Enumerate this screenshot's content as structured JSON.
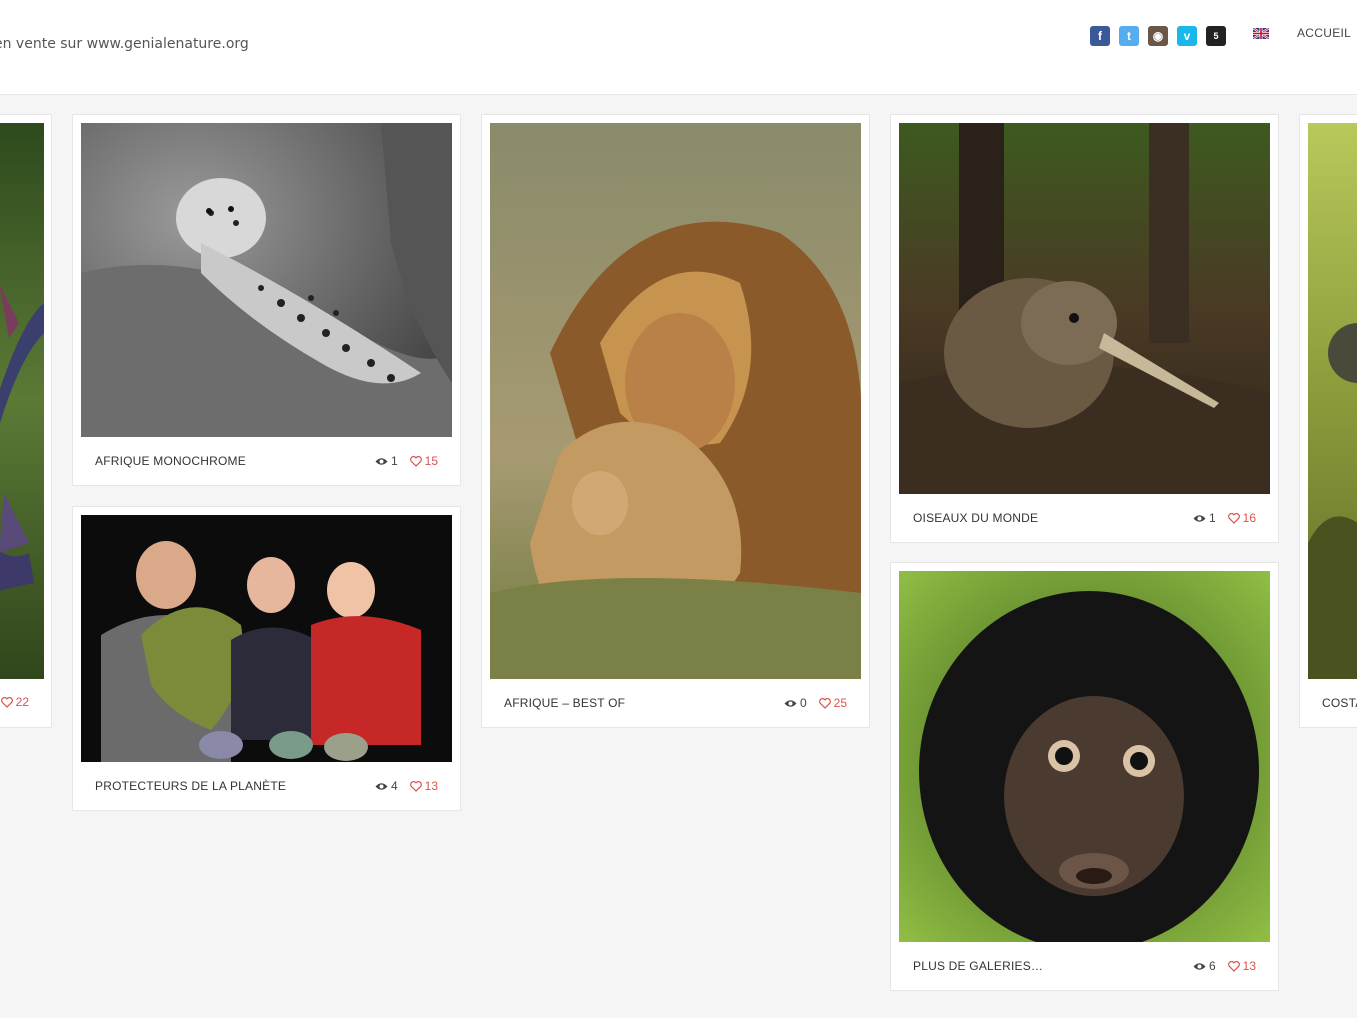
{
  "header": {
    "tagline": "en vente sur www.genialenature.org",
    "social": [
      {
        "name": "facebook-icon",
        "glyph": "f",
        "color": "#3b5998"
      },
      {
        "name": "twitter-icon",
        "glyph": "t",
        "color": "#55acee"
      },
      {
        "name": "instagram-icon",
        "glyph": "◉",
        "color": "#6b5648"
      },
      {
        "name": "vimeo-icon",
        "glyph": "v",
        "color": "#1ab7ea"
      },
      {
        "name": "500px-icon",
        "glyph": "5",
        "color": "#222222"
      }
    ],
    "language_icon": "uk-flag-icon",
    "nav_home": "ACCUEIL"
  },
  "galleries": [
    {
      "title": "",
      "views": "",
      "likes": "22"
    },
    {
      "title": "AFRIQUE MONOCHROME",
      "views": "1",
      "likes": "15"
    },
    {
      "title": "PROTECTEURS DE LA PLANÈTE",
      "views": "4",
      "likes": "13"
    },
    {
      "title": "AFRIQUE – BEST OF",
      "views": "0",
      "likes": "25"
    },
    {
      "title": "OISEAUX DU MONDE",
      "views": "1",
      "likes": "16"
    },
    {
      "title": "PLUS DE GALERIES…",
      "views": "6",
      "likes": "13"
    },
    {
      "title": "COSTA",
      "views": "",
      "likes": ""
    }
  ],
  "colors": {
    "accent_like": "#d9534f",
    "border": "#e6e6e6",
    "background": "#f5f5f5"
  }
}
